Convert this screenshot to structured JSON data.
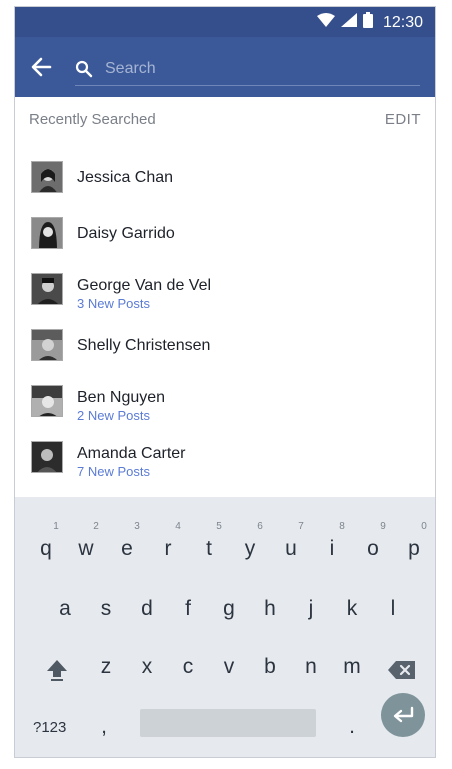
{
  "status_bar": {
    "time": "12:30",
    "icons": [
      "wifi-icon",
      "signal-icon",
      "battery-icon"
    ]
  },
  "header": {
    "back_icon": "arrow-left-icon",
    "search_icon": "search-icon",
    "search_placeholder": "Search",
    "background": "#3b5998"
  },
  "recent": {
    "title": "Recently Searched",
    "edit_label": "EDIT",
    "items": [
      {
        "name": "Jessica Chan",
        "sub": ""
      },
      {
        "name": "Daisy Garrido",
        "sub": ""
      },
      {
        "name": "George Van de Vel",
        "sub": "3 New Posts"
      },
      {
        "name": "Shelly Christensen",
        "sub": ""
      },
      {
        "name": "Ben Nguyen",
        "sub": "2 New Posts"
      },
      {
        "name": "Amanda Carter",
        "sub": "7 New Posts"
      }
    ]
  },
  "keyboard": {
    "row1": [
      "q",
      "w",
      "e",
      "r",
      "t",
      "y",
      "u",
      "i",
      "o",
      "p"
    ],
    "row1_hints": [
      "1",
      "2",
      "3",
      "4",
      "5",
      "6",
      "7",
      "8",
      "9",
      "0"
    ],
    "row2": [
      "a",
      "s",
      "d",
      "f",
      "g",
      "h",
      "j",
      "k",
      "l"
    ],
    "row3": [
      "z",
      "x",
      "c",
      "v",
      "b",
      "n",
      "m"
    ],
    "symbols_label": "?123",
    "comma": ",",
    "period": ".",
    "shift_icon": "shift-icon",
    "delete_icon": "backspace-icon",
    "enter_icon": "enter-icon"
  }
}
